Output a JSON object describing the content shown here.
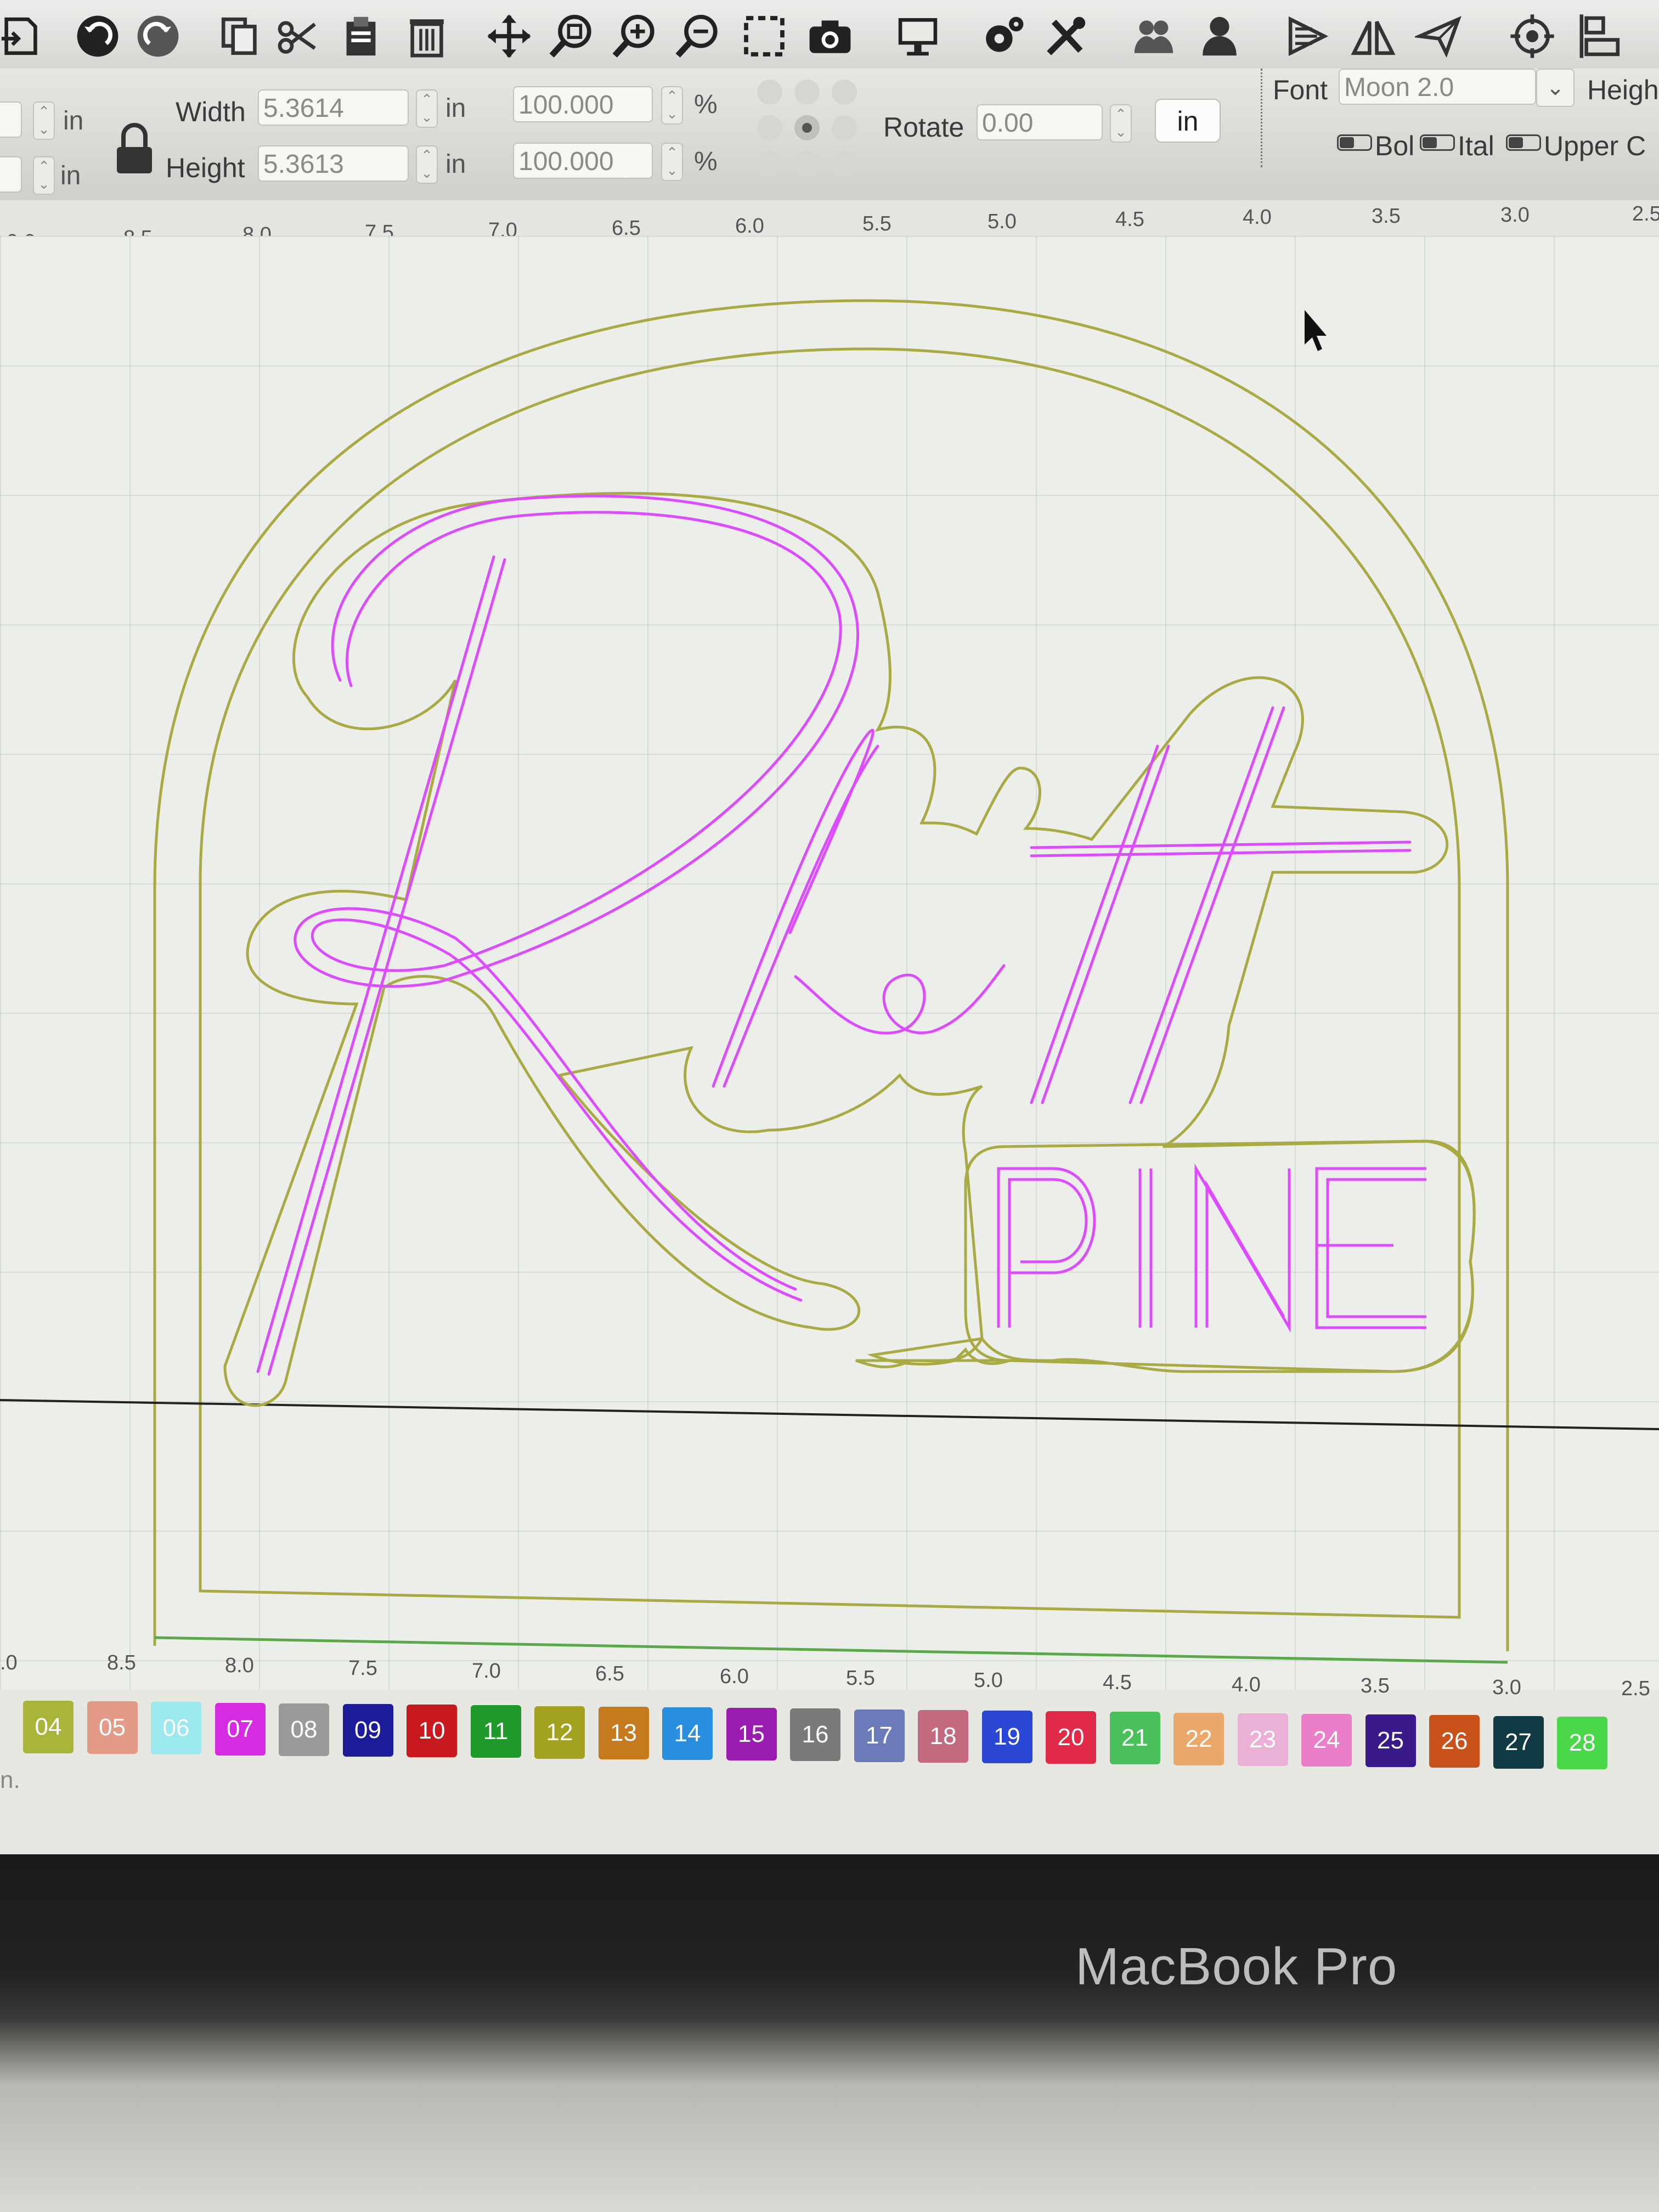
{
  "property_bar": {
    "width_label": "Width",
    "width_value": "5.3614",
    "height_label": "Height",
    "height_value": "5.3613",
    "unit": "in",
    "scale_w": "100.000",
    "scale_h": "100.000",
    "percent": "%",
    "rotate_label": "Rotate",
    "rotate_value": "0.00",
    "in_button": "in",
    "font_label": "Font",
    "font_value": "Moon 2.0",
    "height_cut_label": "Heigh",
    "bold_label": "Bol",
    "italic_label": "Ital",
    "upper_label": "Upper C"
  },
  "top_ruler": [
    "9.0",
    "8.5",
    "8.0",
    "7.5",
    "7.0",
    "6.5",
    "6.0",
    "5.5",
    "5.0",
    "4.5",
    "4.0",
    "3.5",
    "3.0",
    "2.5"
  ],
  "bottom_ruler": [
    ".0",
    "8.5",
    "8.0",
    "7.5",
    "7.0",
    "6.5",
    "6.0",
    "5.5",
    "5.0",
    "4.5",
    "4.0",
    "3.5",
    "3.0",
    "2.5"
  ],
  "design": {
    "script_text": "Rhett",
    "block_text": "PINE",
    "outline_color": "#a6a83a",
    "engrave_color": "#dd4bff"
  },
  "palette": [
    {
      "label": "04",
      "color": "#a8b43a"
    },
    {
      "label": "05",
      "color": "#e39a87"
    },
    {
      "label": "06",
      "color": "#9be8ee"
    },
    {
      "label": "07",
      "color": "#d62be0"
    },
    {
      "label": "08",
      "color": "#9a9a9a"
    },
    {
      "label": "09",
      "color": "#1c1c9a"
    },
    {
      "label": "10",
      "color": "#c8191e"
    },
    {
      "label": "11",
      "color": "#1f9a2a"
    },
    {
      "label": "12",
      "color": "#a3a21e"
    },
    {
      "label": "13",
      "color": "#c47a1d"
    },
    {
      "label": "14",
      "color": "#2b8fe0"
    },
    {
      "label": "15",
      "color": "#9a1bb0"
    },
    {
      "label": "16",
      "color": "#7a7a7a"
    },
    {
      "label": "17",
      "color": "#6b7ab8"
    },
    {
      "label": "18",
      "color": "#c46a7e"
    },
    {
      "label": "19",
      "color": "#2a47d6"
    },
    {
      "label": "20",
      "color": "#e02a48"
    },
    {
      "label": "21",
      "color": "#4ac05a"
    },
    {
      "label": "22",
      "color": "#eaa86a"
    },
    {
      "label": "23",
      "color": "#eab0d6"
    },
    {
      "label": "24",
      "color": "#ea7ec8"
    },
    {
      "label": "25",
      "color": "#3a1a8a"
    },
    {
      "label": "26",
      "color": "#c8521a"
    },
    {
      "label": "27",
      "color": "#103a44"
    },
    {
      "label": "28",
      "color": "#4ad84a"
    }
  ],
  "status_text": "n.",
  "laptop_brand": "MacBook Pro"
}
